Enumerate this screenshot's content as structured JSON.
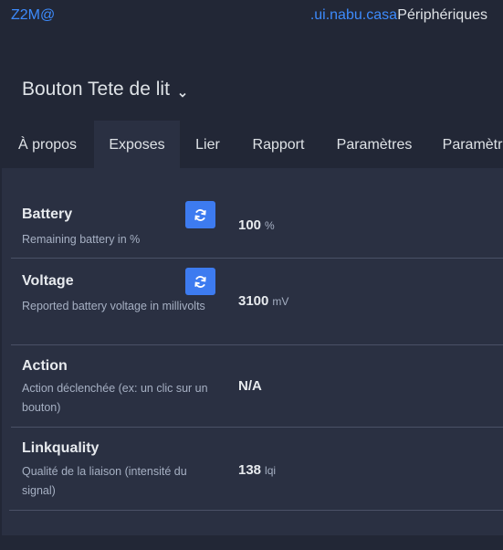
{
  "header": {
    "brand": "Z2M@",
    "host": ".ui.nabu.casa",
    "devices_link": "Périphériques"
  },
  "device": {
    "title": "Bouton Tete de lit"
  },
  "tabs": [
    {
      "label": "À propos"
    },
    {
      "label": "Exposes"
    },
    {
      "label": "Lier"
    },
    {
      "label": "Rapport"
    },
    {
      "label": "Paramètres"
    },
    {
      "label": "Paramètres"
    }
  ],
  "exposes": [
    {
      "name": "Battery",
      "description": "Remaining battery in %",
      "value": "100",
      "unit": "%",
      "refresh": true
    },
    {
      "name": "Voltage",
      "description": "Reported battery voltage in millivolts",
      "value": "3100",
      "unit": "mV",
      "refresh": true
    },
    {
      "name": "Action",
      "description": "Action déclenchée (ex: un clic sur un bouton)",
      "value": "N/A",
      "unit": "",
      "refresh": false
    },
    {
      "name": "Linkquality",
      "description": "Qualité de la liaison (intensité du signal)",
      "value": "138",
      "unit": "lqi",
      "refresh": false
    }
  ],
  "colors": {
    "background": "#222736",
    "panel": "#2a3042",
    "accent": "#3d8bfd",
    "refresh_button": "#3d7bf0"
  }
}
